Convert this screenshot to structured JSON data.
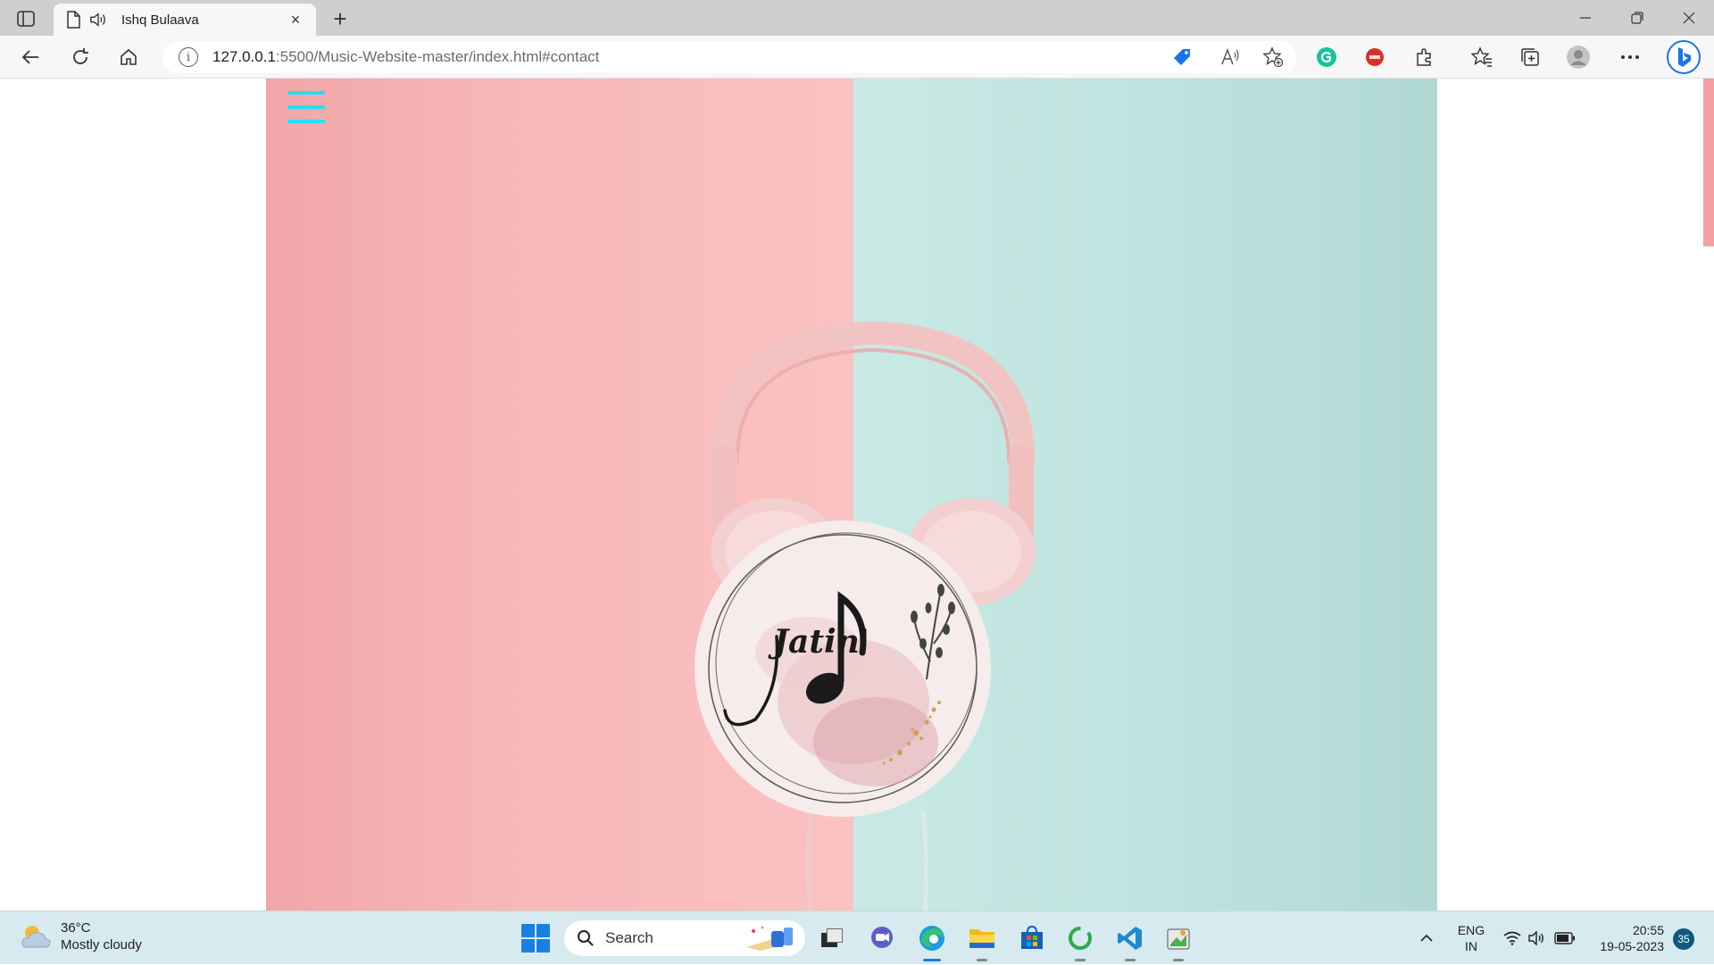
{
  "browser": {
    "tab_title": "Ishq Bulaava",
    "url_host": "127.0.0.1",
    "url_rest": ":5500/Music-Website-master/index.html#contact",
    "new_tab": "+",
    "close_tab": "×"
  },
  "page": {
    "logo_text": "Jatin'",
    "colors": {
      "left_panel": "#f7b7b7",
      "right_panel": "#bfe4df",
      "hamburger": "#22e0f0"
    }
  },
  "taskbar": {
    "weather_temp": "36°C",
    "weather_desc": "Mostly cloudy",
    "search_label": "Search",
    "lang_top": "ENG",
    "lang_bottom": "IN",
    "time": "20:55",
    "date": "19-05-2023",
    "notification_count": "35"
  }
}
